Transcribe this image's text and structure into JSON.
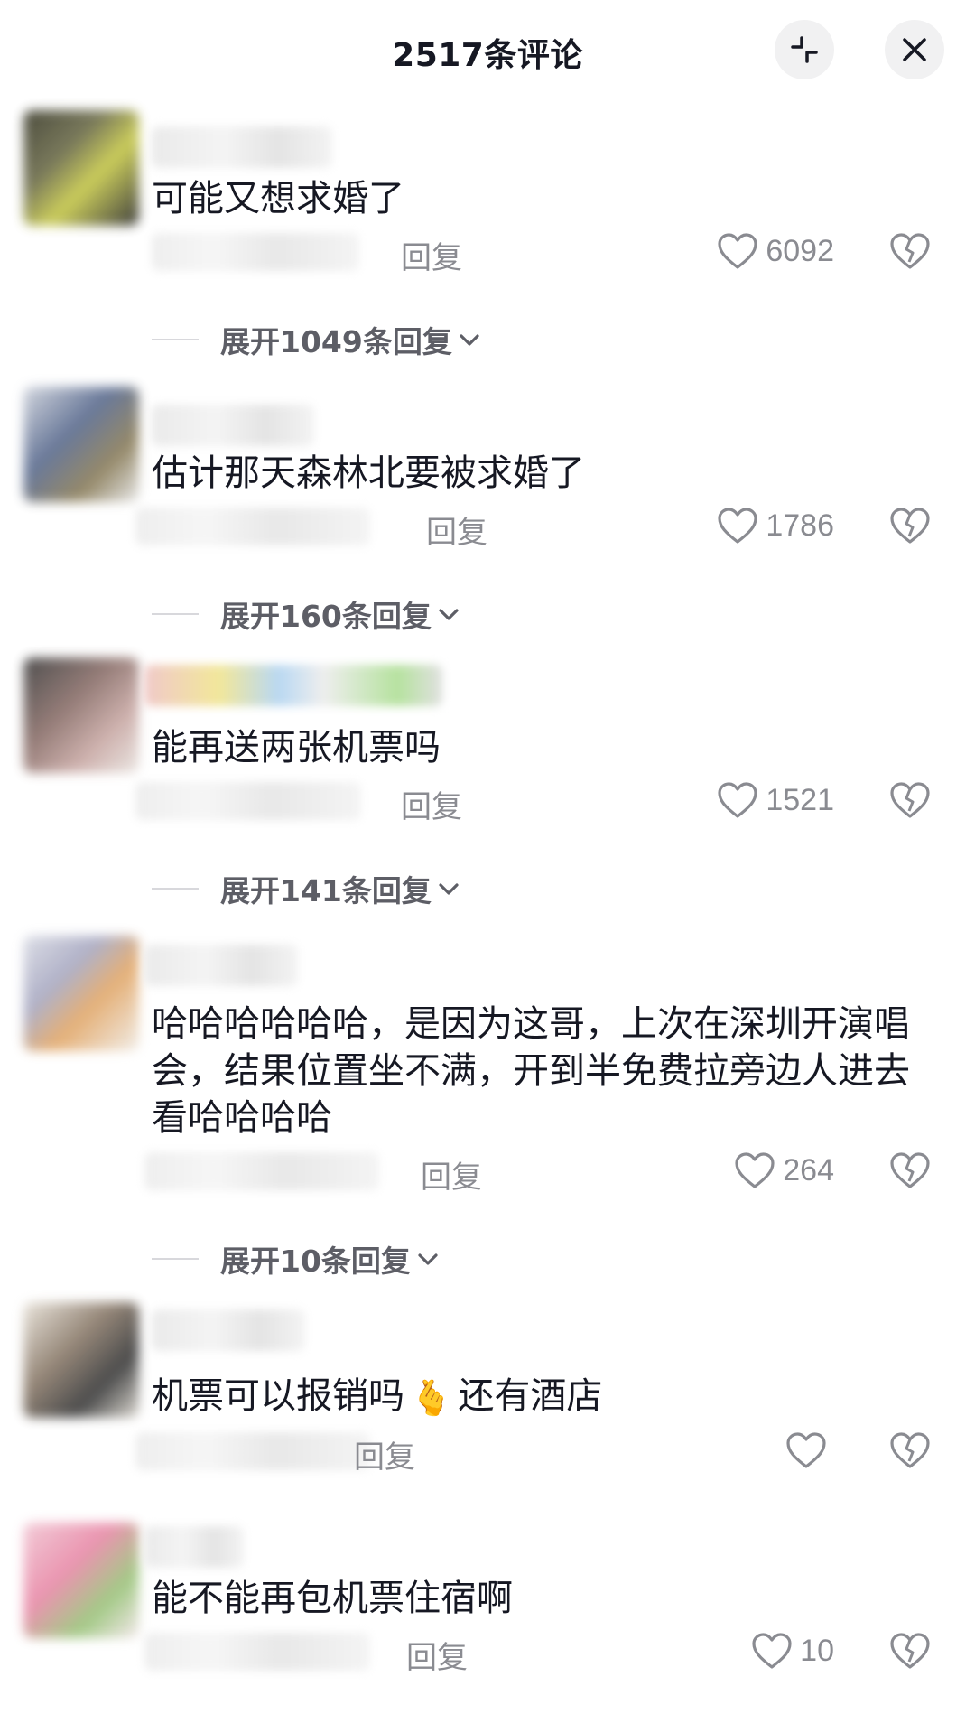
{
  "header": {
    "title": "2517条评论"
  },
  "comments": [
    {
      "text": "可能又想求婚了",
      "reply_label": "回复",
      "likes": "6092",
      "expand_label": "展开1049条回复"
    },
    {
      "text": "估计那天森林北要被求婚了",
      "reply_label": "回复",
      "likes": "1786",
      "expand_label": "展开160条回复"
    },
    {
      "text": "能再送两张机票吗",
      "reply_label": "回复",
      "likes": "1521",
      "expand_label": "展开141条回复"
    },
    {
      "text": "哈哈哈哈哈哈，是因为这哥，上次在深圳开演唱会，结果位置坐不满，开到半免费拉旁边人进去看哈哈哈哈",
      "reply_label": "回复",
      "likes": "264",
      "expand_label": "展开10条回复"
    },
    {
      "text_before": "机票可以报销吗",
      "emoji": "🫰",
      "text_after": "还有酒店",
      "reply_label": "回复",
      "likes": ""
    },
    {
      "text": "能不能再包机票住宿啊",
      "reply_label": "回复",
      "likes": "10"
    }
  ],
  "colors": {
    "text_primary": "#161823",
    "text_secondary": "#8a8b91",
    "expand_text": "#5d5e66",
    "button_bg": "#f1f1f2"
  }
}
